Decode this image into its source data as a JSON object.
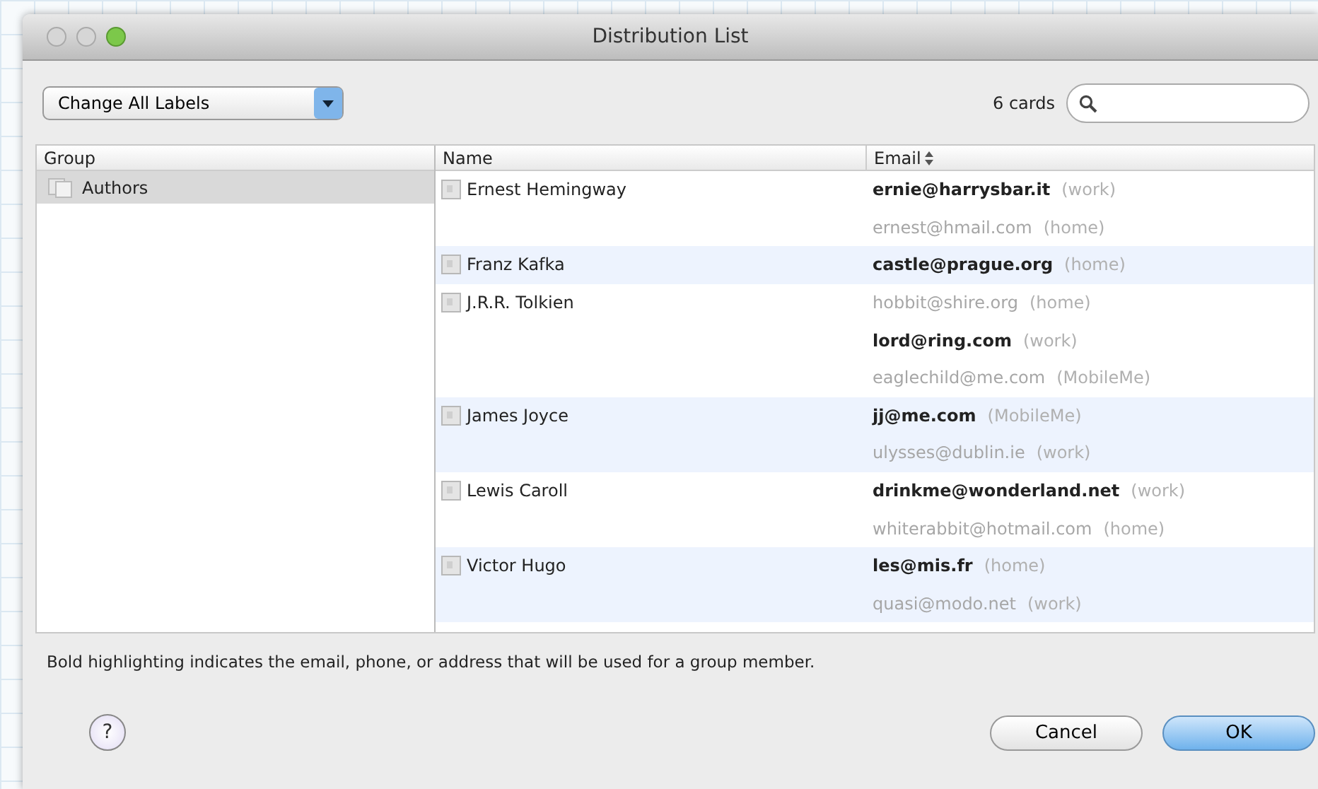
{
  "window": {
    "title": "Distribution List"
  },
  "toolbar": {
    "label_menu": "Change All Labels",
    "card_count": "6 cards"
  },
  "groups": {
    "header": "Group",
    "items": [
      {
        "name": "Authors",
        "selected": true
      }
    ]
  },
  "contacts": {
    "columns": [
      "Name",
      "Email"
    ],
    "rows": [
      {
        "name": "Ernest Hemingway",
        "emails": [
          {
            "address": "ernie@harrysbar.it",
            "label": "(work)",
            "primary": true
          },
          {
            "address": "ernest@hmail.com",
            "label": "(home)",
            "primary": false
          }
        ]
      },
      {
        "name": "Franz Kafka",
        "emails": [
          {
            "address": "castle@prague.org",
            "label": "(home)",
            "primary": true
          }
        ]
      },
      {
        "name": "J.R.R. Tolkien",
        "emails": [
          {
            "address": "hobbit@shire.org",
            "label": "(home)",
            "primary": false
          },
          {
            "address": "lord@ring.com",
            "label": "(work)",
            "primary": true
          },
          {
            "address": "eaglechild@me.com",
            "label": "(MobileMe)",
            "primary": false
          }
        ]
      },
      {
        "name": "James Joyce",
        "emails": [
          {
            "address": "jj@me.com",
            "label": "(MobileMe)",
            "primary": true
          },
          {
            "address": "ulysses@dublin.ie",
            "label": "(work)",
            "primary": false
          }
        ]
      },
      {
        "name": "Lewis Caroll",
        "emails": [
          {
            "address": "drinkme@wonderland.net",
            "label": "(work)",
            "primary": true
          },
          {
            "address": "whiterabbit@hotmail.com",
            "label": "(home)",
            "primary": false
          }
        ]
      },
      {
        "name": "Victor Hugo",
        "emails": [
          {
            "address": "les@mis.fr",
            "label": "(home)",
            "primary": true
          },
          {
            "address": "quasi@modo.net",
            "label": "(work)",
            "primary": false
          }
        ]
      }
    ]
  },
  "footer": {
    "note": "Bold highlighting indicates the email, phone, or address that will be used for a group member.",
    "help": "?",
    "buttons": [
      {
        "label": "Cancel",
        "default": false
      },
      {
        "label": "OK",
        "default": true
      }
    ]
  }
}
